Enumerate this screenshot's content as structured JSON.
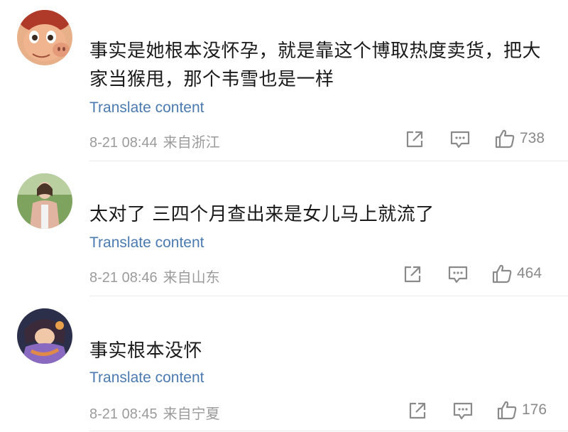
{
  "comments": [
    {
      "username": "",
      "text": "事实是她根本没怀孕，就是靠这个博取热度卖货，把大家当猴甩，那个韦雪也是一样",
      "translate": "Translate content",
      "time": "8-21 08:44",
      "location": "来自浙江",
      "likes": "738",
      "avatar_icon": "cartoon-pig-avatar"
    },
    {
      "username": "",
      "text": "太对了 三四个月查出来是女儿马上就流了",
      "translate": "Translate content",
      "time": "8-21 08:46",
      "location": "来自山东",
      "likes": "464",
      "avatar_icon": "photo-person-avatar"
    },
    {
      "username": "",
      "text": "事实根本没怀",
      "translate": "Translate content",
      "time": "8-21 08:45",
      "location": "来自宁夏",
      "likes": "176",
      "avatar_icon": "anime-avatar"
    }
  ],
  "colors": {
    "link": "#4b7ab0",
    "meta": "#9b9b9b",
    "text": "#1a1a1a",
    "divider": "#ececec"
  }
}
